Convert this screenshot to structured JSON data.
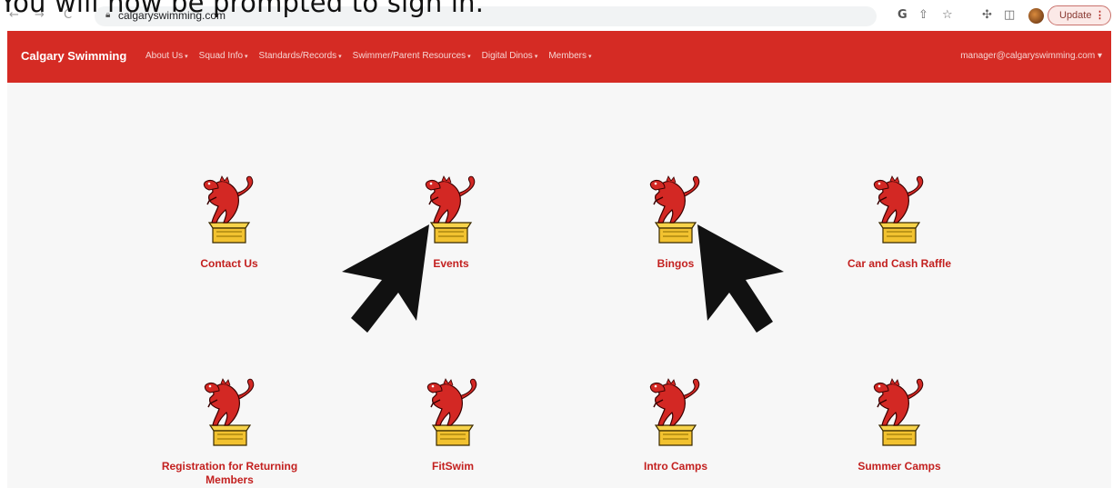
{
  "caption": "You will now be prompted to sign in.",
  "browser": {
    "back": "←",
    "forward": "→",
    "reload": "C",
    "lock_icon": "lock-icon",
    "url": "calgaryswimming.com",
    "google_icon": "G",
    "share_icon": "⇧",
    "star_icon": "☆",
    "extensions_icon": "✣",
    "sidepanel_icon": "◫",
    "update_label": "Update",
    "menu_dots": "⋮"
  },
  "navbar": {
    "brand": "Calgary Swimming",
    "menu": [
      {
        "label": "About Us"
      },
      {
        "label": "Squad Info"
      },
      {
        "label": "Standards/Records"
      },
      {
        "label": "Swimmer/Parent Resources"
      },
      {
        "label": "Digital Dinos"
      },
      {
        "label": "Members"
      }
    ],
    "account": "manager@calgaryswimming.com",
    "caret": "▾"
  },
  "tiles": [
    {
      "label": "Contact Us"
    },
    {
      "label": "Events"
    },
    {
      "label": "Bingos"
    },
    {
      "label": "Car and Cash Raffle"
    },
    {
      "label": "Registration for Returning Members"
    },
    {
      "label": "FitSwim"
    },
    {
      "label": "Intro Camps"
    },
    {
      "label": "Summer Camps"
    }
  ],
  "colors": {
    "navbar": "#d52b24",
    "tile_label": "#c3201f",
    "dino_body": "#d32824",
    "pedestal": "#f2c230"
  }
}
